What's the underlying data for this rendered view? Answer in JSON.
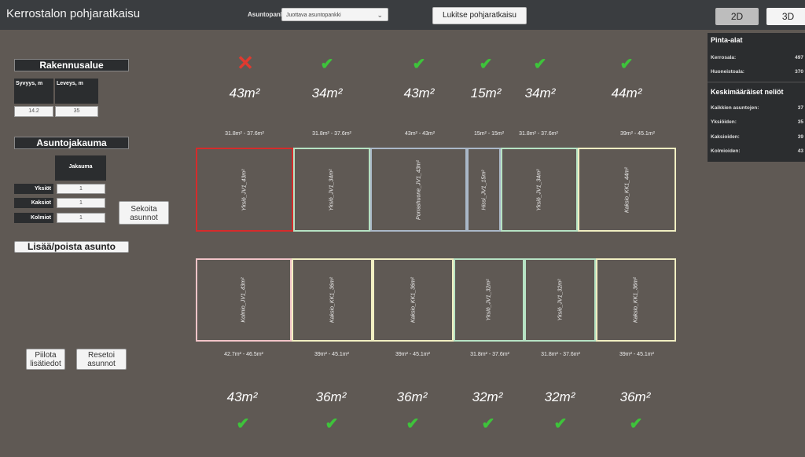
{
  "app": {
    "title": "Kerrostalon pohjaratkaisu"
  },
  "toolbar": {
    "bank_label": "Asuntopankki:",
    "bank_selected": "Juottava asuntopankki",
    "lock_label": "Lukitse pohjaratkaisu",
    "view_2d": "2D",
    "view_3d": "3D"
  },
  "rakennusalue": {
    "title": "Rakennusalue",
    "depth_label": "Syvyys, m",
    "width_label": "Leveys, m",
    "depth_value": "14.2",
    "width_value": "35"
  },
  "asuntojakauma": {
    "title": "Asuntojakauma",
    "col_header": "Jakauma",
    "rows": [
      {
        "label": "Yksiöt",
        "value": "1"
      },
      {
        "label": "Kaksiot",
        "value": "1"
      },
      {
        "label": "Kolmiot",
        "value": "1"
      }
    ],
    "shuffle_label": "Sekoita asunnot"
  },
  "add_remove_label": "Lisää/poista asunto",
  "hide_details_label": "Piilota lisätiedot",
  "reset_label": "Resetoi asunnot",
  "top_row": [
    {
      "status": "bad",
      "area": "43m²",
      "range": "31.8m² - 37.6m²",
      "label": "Yksiö_JV1_43m²",
      "color": "#d62b2b"
    },
    {
      "status": "ok",
      "area": "34m²",
      "range": "31.8m² - 37.6m²",
      "label": "Yksiö_JV1_34m²",
      "color": "#b6e3c4"
    },
    {
      "status": "ok",
      "area": "43m²",
      "range": "43m² - 43m²",
      "label": "Porrashuone_JV1_43m²",
      "color": "#aab8c8"
    },
    {
      "status": "ok",
      "area": "15m²",
      "range": "15m² - 15m²",
      "label": "Hissi_JV1_15m²",
      "color": "#aab8c8"
    },
    {
      "status": "ok",
      "area": "34m²",
      "range": "31.8m² - 37.6m²",
      "label": "Yksiö_JV1_34m²",
      "color": "#b6e3c4"
    },
    {
      "status": "ok",
      "area": "44m²",
      "range": "39m² - 45.1m²",
      "label": "Kaksio_KK1_44m²",
      "color": "#f1efc2"
    }
  ],
  "bottom_row": [
    {
      "status": "ok",
      "area": "43m²",
      "range": "42.7m² - 46.5m²",
      "label": "Kolmio_JV1_43m²",
      "color": "#f2c4c8"
    },
    {
      "status": "ok",
      "area": "36m²",
      "range": "39m² - 45.1m²",
      "label": "Kaksio_KK1_36m²",
      "color": "#f1efc2"
    },
    {
      "status": "ok",
      "area": "36m²",
      "range": "39m² - 45.1m²",
      "label": "Kaksio_KK1_36m²",
      "color": "#f1efc2"
    },
    {
      "status": "ok",
      "area": "32m²",
      "range": "31.8m² - 37.6m²",
      "label": "Yksiö_JV1_32m²",
      "color": "#b6e3c4"
    },
    {
      "status": "ok",
      "area": "32m²",
      "range": "31.8m² - 37.6m²",
      "label": "Yksiö_JV1_32m²",
      "color": "#b6e3c4"
    },
    {
      "status": "ok",
      "area": "36m²",
      "range": "39m² - 45.1m²",
      "label": "Kaksio_KK1_36m²",
      "color": "#f1efc2"
    }
  ],
  "stats": {
    "pinta_title": "Pinta-alat",
    "kerrosala_label": "Kerrosala:",
    "kerrosala_value": "497",
    "huoneistoala_label": "Huoneistoala:",
    "huoneistoala_value": "370",
    "avg_title": "Keskimääräiset neliöt",
    "avg_rows": [
      {
        "label": "Kaikkien asuntojen:",
        "value": "37"
      },
      {
        "label": "Yksiöiden:",
        "value": "35"
      },
      {
        "label": "Kaksioiden:",
        "value": "39"
      },
      {
        "label": "Kolmioiden:",
        "value": "43"
      }
    ]
  },
  "colors": {
    "ok": "#3ec33b",
    "bad": "#e03a2f"
  }
}
